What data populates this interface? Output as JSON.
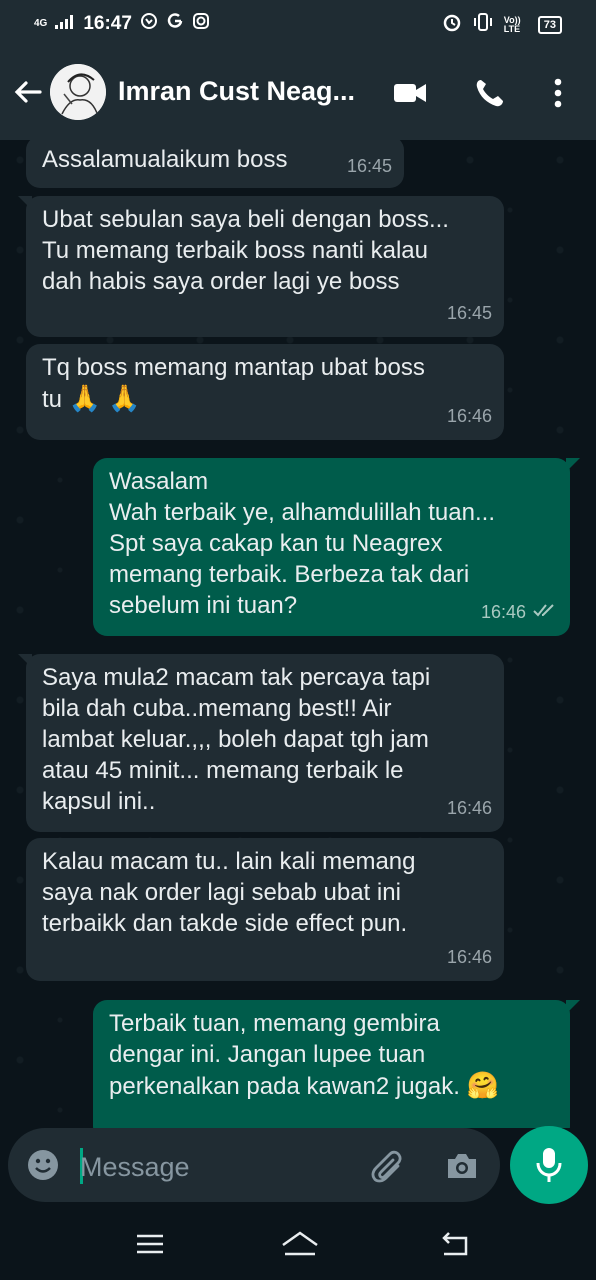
{
  "statusbar": {
    "network": "4G",
    "time": "16:47",
    "icons": [
      "whatsapp-icon",
      "g-icon",
      "instagram-icon"
    ],
    "right_icons": [
      "alarm-icon",
      "vibrate-icon",
      "volte-icon"
    ],
    "volte": "Vo)) LTE",
    "battery": "73"
  },
  "header": {
    "title": "Imran Cust Neag...",
    "icons": [
      "back-arrow-icon",
      "video-call-icon",
      "phone-icon",
      "more-vert-icon"
    ]
  },
  "messages": [
    {
      "dir": "in",
      "text": "Assalamualaikum boss",
      "time": "16:45"
    },
    {
      "dir": "in",
      "text": "Ubat sebulan saya beli dengan boss...\nTu memang terbaik boss nanti kalau\ndah habis saya order lagi ye boss",
      "time": "16:45"
    },
    {
      "dir": "in",
      "text": "Tq boss memang mantap ubat boss\ntu",
      "emoji": "🙏 🙏",
      "time": "16:46"
    },
    {
      "dir": "out",
      "text": "Wasalam\nWah terbaik ye, alhamdulillah tuan...\nSpt saya cakap kan tu Neagrex\nmemang terbaik. Berbeza tak dari\nsebelum ini tuan?",
      "time": "16:46",
      "status": "read"
    },
    {
      "dir": "in",
      "text": "Saya mula2 macam tak percaya tapi\nbila dah cuba..memang best!! Air\nlambat keluar.,,, boleh dapat tgh jam\natau 45 minit... memang terbaik le\nkapsul ini..",
      "time": "16:46"
    },
    {
      "dir": "in",
      "text": "Kalau macam tu.. lain kali memang\nsaya nak order lagi sebab ubat ini\nterbaikk dan takde side effect pun.",
      "time": "16:46"
    },
    {
      "dir": "out",
      "text": "Terbaik tuan, memang gembira\ndengar ini. Jangan lupee tuan\nperkenalkan pada kawan2 jugak.",
      "emoji": "🤗"
    }
  ],
  "composer": {
    "placeholder": "Message",
    "icons": [
      "emoji-icon",
      "attach-icon",
      "camera-icon",
      "mic-icon"
    ]
  },
  "navbar": {
    "icons": [
      "menu-icon",
      "home-icon",
      "back-icon"
    ]
  },
  "colors": {
    "incoming": "#202c33",
    "outgoing": "#005c4b",
    "accent": "#00a884",
    "background": "#0b141a"
  }
}
